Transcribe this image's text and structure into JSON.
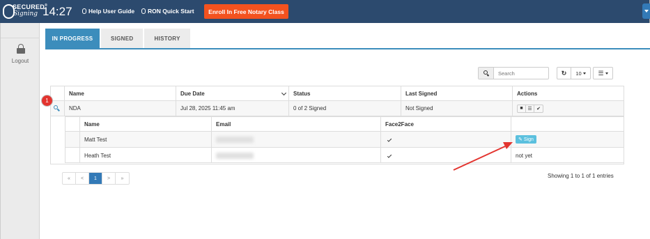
{
  "topbar": {
    "logo_word_top": "SECURED",
    "logo_mark": "®",
    "logo_word_bottom": "Signing",
    "clock": "14:27",
    "help_guide": "Help User Guide",
    "ron_start": "RON Quick Start",
    "enroll": "Enroll In Free Notary Class",
    "help_icon": "lightbulb-icon",
    "ron_icon": "lightbulb-icon"
  },
  "sidebar": {
    "logout_label": "Logout",
    "logout_icon": "unlock-icon"
  },
  "tabs": [
    {
      "label": "IN PROGRESS",
      "active": true
    },
    {
      "label": "SIGNED",
      "active": false
    },
    {
      "label": "HISTORY",
      "active": false
    }
  ],
  "toolbar": {
    "search_placeholder": "Search",
    "page_size": "10",
    "refresh_icon": "refresh-icon",
    "columns_icon": "list-columns-icon"
  },
  "table": {
    "headers": [
      "Name",
      "Due Date",
      "Status",
      "Last Signed",
      "Actions"
    ],
    "rows": [
      {
        "name": "NDA",
        "due_date": "Jul 28, 2025 11:45 am",
        "status": "0 of 2 Signed",
        "last_signed": "Not Signed"
      }
    ]
  },
  "subtable": {
    "headers": [
      "Name",
      "Email",
      "Face2Face",
      ""
    ],
    "rows": [
      {
        "name": "Matt Test",
        "face2face": true,
        "action": "Sign"
      },
      {
        "name": "Heath Test",
        "face2face": true,
        "action": "not yet"
      }
    ]
  },
  "annotation": {
    "badge": "1"
  },
  "pagination": {
    "first": "«",
    "prev": "<",
    "current": "1",
    "next": ">",
    "last": "»"
  },
  "footer": {
    "showing": "Showing 1 to 1 of 1 entries"
  },
  "colors": {
    "topbar": "#2c4a6e",
    "accent": "#3c8dbc",
    "enroll": "#f3521f",
    "sign": "#5bc0de",
    "arrow": "#e3342f"
  }
}
